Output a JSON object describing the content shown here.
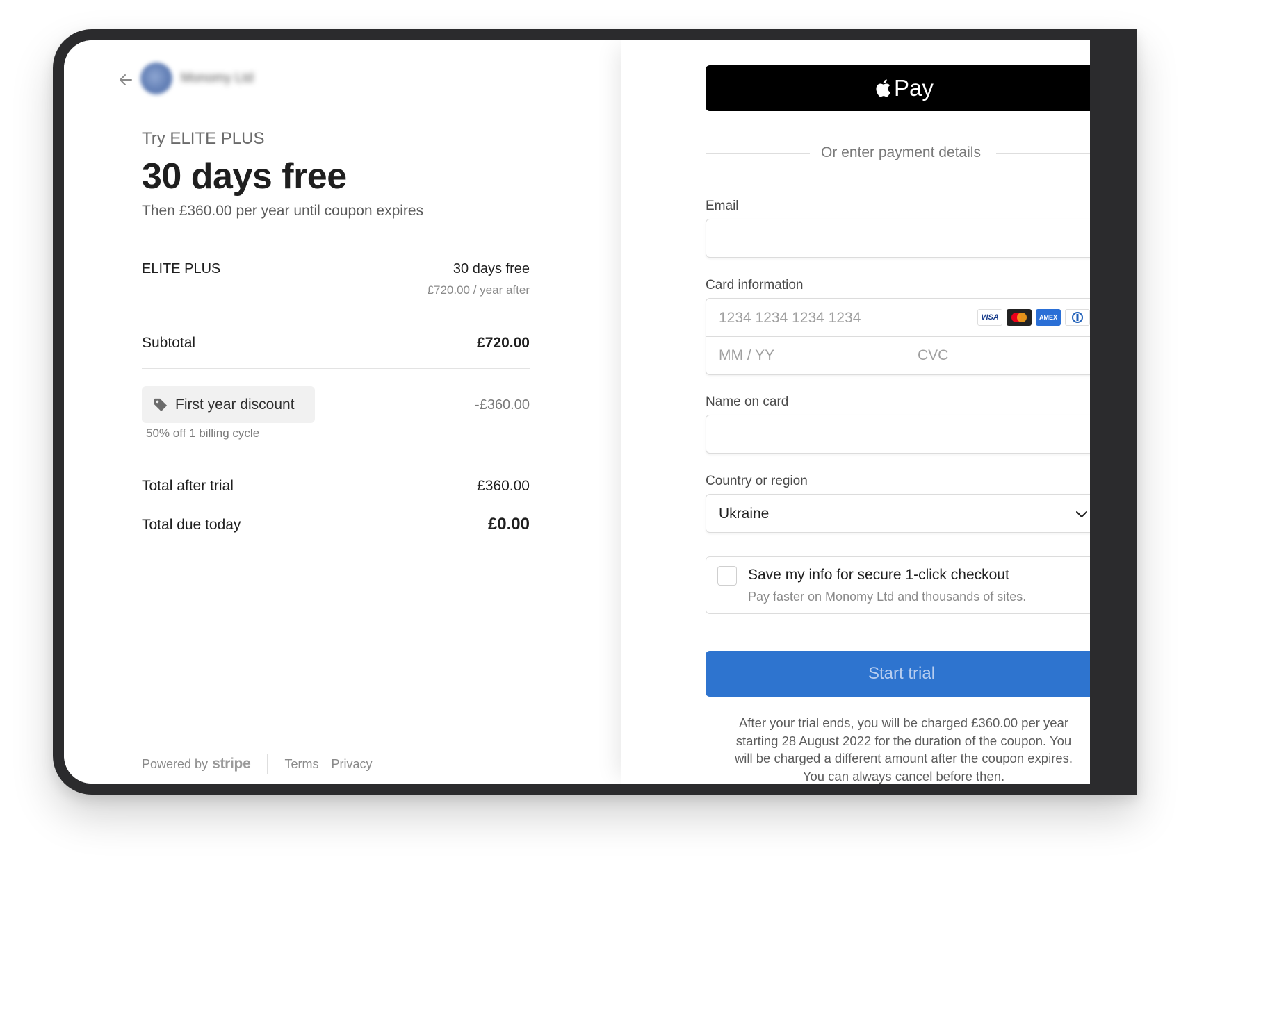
{
  "merchant": {
    "name": "Monomy Ltd",
    "back_icon": "arrow-left-icon"
  },
  "offer": {
    "try_text": "Try ELITE PLUS",
    "headline": "30 days free",
    "then_text": "Then £360.00 per year until coupon expires"
  },
  "summary": {
    "plan_name": "ELITE PLUS",
    "plan_price": "30 days free",
    "plan_after": "£720.00 / year after",
    "subtotal_label": "Subtotal",
    "subtotal_value": "£720.00",
    "discount_label": "First year discount",
    "discount_value": "-£360.00",
    "discount_note": "50% off 1 billing cycle",
    "total_after_trial_label": "Total after trial",
    "total_after_trial_value": "£360.00",
    "total_due_today_label": "Total due today",
    "total_due_today_value": "£0.00"
  },
  "footer": {
    "powered_by": "Powered by",
    "stripe": "stripe",
    "terms": "Terms",
    "privacy": "Privacy"
  },
  "payment": {
    "apple_pay_label": "Pay",
    "or_text": "Or enter payment details",
    "email_label": "Email",
    "email_value": "",
    "card_label": "Card information",
    "card_number_placeholder": "1234 1234 1234 1234",
    "expiry_placeholder": "MM / YY",
    "cvc_placeholder": "CVC",
    "card_brands": [
      "VISA",
      "mastercard",
      "AMEX",
      "diners"
    ],
    "name_label": "Name on card",
    "name_value": "",
    "country_label": "Country or region",
    "country_value": "Ukraine",
    "save_title": "Save my info for secure 1-click checkout",
    "save_subtitle": "Pay faster on Monomy Ltd and thousands of sites.",
    "save_checked": false,
    "start_button": "Start trial",
    "legal": "After your trial ends, you will be charged £360.00 per year\nstarting 28 August 2022 for the duration of the coupon. You\nwill be charged a different amount after the coupon expires.\nYou can always cancel before then."
  },
  "colors": {
    "primary_button": "#2e74cf",
    "apple_pay": "#000000"
  }
}
